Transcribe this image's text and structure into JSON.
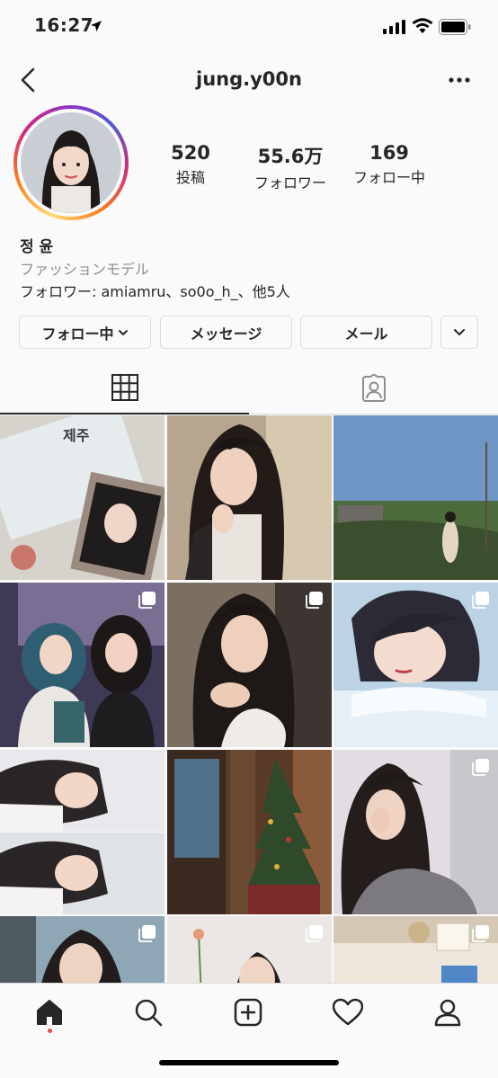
{
  "status_bar": {
    "time": "16:27",
    "icons": [
      "location-arrow-icon",
      "signal-icon",
      "wifi-icon",
      "battery-icon"
    ]
  },
  "header": {
    "username": "jung.y00n",
    "icons": [
      "back-icon",
      "more-options-icon"
    ]
  },
  "profile": {
    "stats": {
      "posts": {
        "value": "520",
        "label": "投稿"
      },
      "followers": {
        "value": "55.6万",
        "label": "フォロワー"
      },
      "following": {
        "value": "169",
        "label": "フォロー中"
      }
    },
    "name": "정 윤",
    "category": "ファッションモデル",
    "followed_by": "フォロワー: amiamru、so0o_h_、他5人"
  },
  "buttons": {
    "following": "フォロー中",
    "message": "メッセージ",
    "email": "メール"
  },
  "tabs": [
    "grid-icon",
    "tagged-icon"
  ],
  "grid": {
    "post_count_visible": 12,
    "multi_photo_marks": [
      3,
      4,
      5,
      8,
      9,
      10
    ]
  },
  "bottom_nav": [
    "home-icon",
    "search-icon",
    "add-post-icon",
    "heart-icon",
    "profile-icon"
  ],
  "colors": {
    "text": "#262626",
    "secondary": "#8e8e8e",
    "border": "#dbdbdb",
    "background": "#fafafa",
    "notification": "#ed4956"
  }
}
